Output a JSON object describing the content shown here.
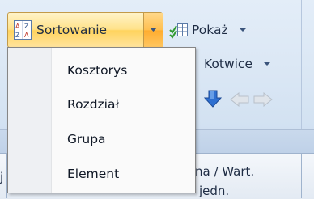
{
  "ribbon": {
    "sort_button": {
      "label": "Sortowanie",
      "icon": "sort-az-icon",
      "accent_color": "#ffd35e"
    },
    "show_button": {
      "label": "Pokaż",
      "icon": "show-columns-icon"
    },
    "anchors_button": {
      "label": "Kotwice"
    },
    "nav_icons": [
      "arrow-down-icon",
      "arrow-left-icon",
      "arrow-right-icon"
    ]
  },
  "sort_menu": {
    "items": [
      {
        "label": "Kosztorys"
      },
      {
        "label": "Rozdział"
      },
      {
        "label": "Grupa"
      },
      {
        "label": "Element"
      }
    ]
  },
  "grid": {
    "header_left_fragment": "j",
    "header_col_line1": "na / Wart.",
    "header_col_line2": "jedn."
  }
}
